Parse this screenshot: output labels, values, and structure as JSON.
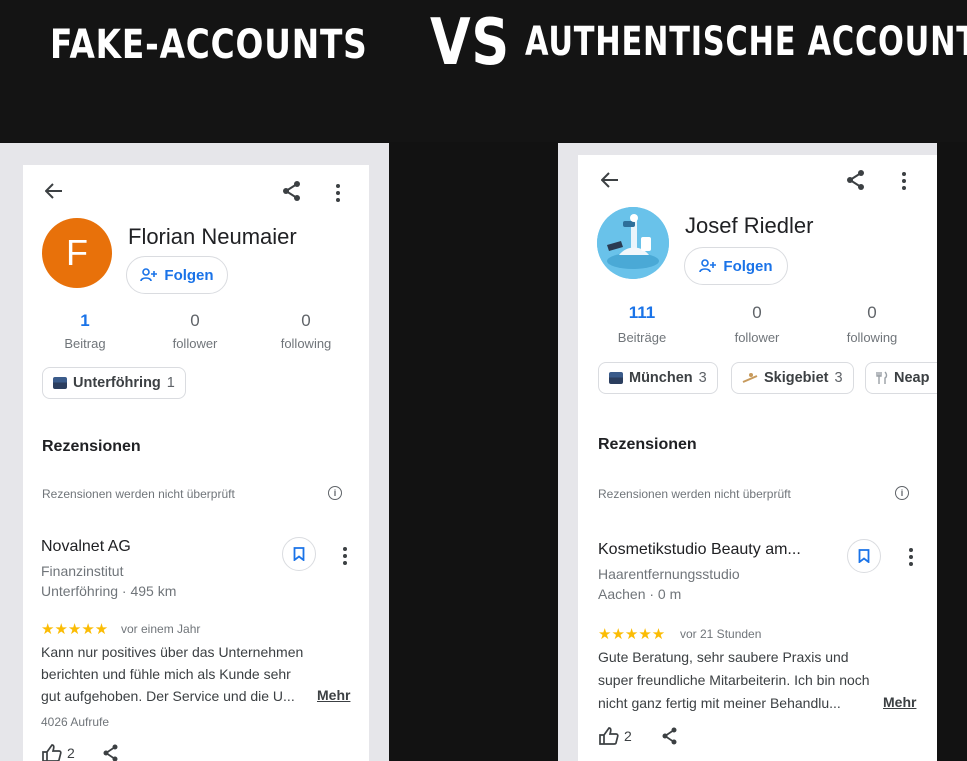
{
  "banner": {
    "left_title": "FAKE-ACCOUNTS",
    "vs": "VS",
    "right_title": "AUTHENTISCHE ACCOUNTS"
  },
  "colors": {
    "accent_blue": "#1a73e8",
    "avatar_orange": "#e8710a",
    "star_yellow": "#fbbc04"
  },
  "left_profile": {
    "avatar_letter": "F",
    "name": "Florian Neumaier",
    "follow_label": "Folgen",
    "stats": [
      {
        "value": "1",
        "label": "Beitrag"
      },
      {
        "value": "0",
        "label": "follower"
      },
      {
        "value": "0",
        "label": "following"
      }
    ],
    "chips": [
      {
        "icon": "city-icon",
        "label": "Unterföhring",
        "count": "1"
      }
    ],
    "section_title": "Rezensionen",
    "hint": "Rezensionen werden nicht überprüft",
    "review": {
      "business": "Novalnet AG",
      "category": "Finanzinstitut",
      "location": "Unterföhring · 495 km",
      "stars": "★★★★★",
      "when": "vor einem Jahr",
      "lines": [
        "Kann nur positives über das Unternehmen",
        "berichten und fühle mich als Kunde sehr",
        "gut aufgehoben. Der Service und die U..."
      ],
      "more": "Mehr",
      "views": "4026 Aufrufe",
      "likes": "2"
    }
  },
  "right_profile": {
    "name": "Josef Riedler",
    "follow_label": "Folgen",
    "stats": [
      {
        "value": "111",
        "label": "Beiträge"
      },
      {
        "value": "0",
        "label": "follower"
      },
      {
        "value": "0",
        "label": "following"
      }
    ],
    "chips": [
      {
        "icon": "city-icon",
        "label": "München",
        "count": "3"
      },
      {
        "icon": "ski-icon",
        "label": "Skigebiet",
        "count": "3"
      },
      {
        "icon": "fork-knife-icon",
        "label": "Neap",
        "count": ""
      }
    ],
    "section_title": "Rezensionen",
    "hint": "Rezensionen werden nicht überprüft",
    "review": {
      "business": "Kosmetikstudio Beauty am...",
      "category": "Haarentfernungsstudio",
      "location": "Aachen · 0 m",
      "stars": "★★★★★",
      "when": "vor 21 Stunden",
      "lines": [
        "Gute Beratung, sehr saubere Praxis und",
        "super freundliche Mitarbeiterin. Ich bin noch",
        "nicht ganz fertig mit meiner Behandlu..."
      ],
      "more": "Mehr",
      "likes": "2"
    }
  }
}
